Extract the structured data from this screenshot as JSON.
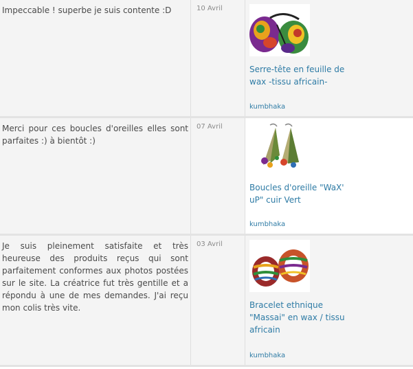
{
  "reviews": [
    {
      "comment": "Impeccable ! superbe je suis contente :D",
      "date": "10 Avril",
      "product_name": "Serre-tête en feuille de wax -tissu africain-",
      "shop": "kumbhaka",
      "image": "headband-image"
    },
    {
      "comment": "Merci pour ces boucles d'oreilles elles sont parfaites :) à bientôt :)",
      "date": "07 Avril",
      "product_name": "Boucles d'oreille \"WaX' uP\" cuir Vert",
      "shop": "kumbhaka",
      "image": "earrings-image"
    },
    {
      "comment": "Je suis pleinement satisfaite et très heureuse des produits reçus qui sont parfaitement conformes aux photos postées sur le site. La créatrice fut très gentille et a répondu à une de mes demandes. J'ai reçu mon colis très vite.",
      "date": "03 Avril",
      "product_name": "Bracelet ethnique \"Massai\" en wax / tissu africain",
      "shop": "kumbhaka",
      "image": "bracelet-image"
    }
  ],
  "colors": {
    "link": "#2e7ba5",
    "text": "#4a4a4a",
    "date": "#8a8a8a",
    "row_bg": "#f4f4f4",
    "divider": "#e3e3e3"
  }
}
